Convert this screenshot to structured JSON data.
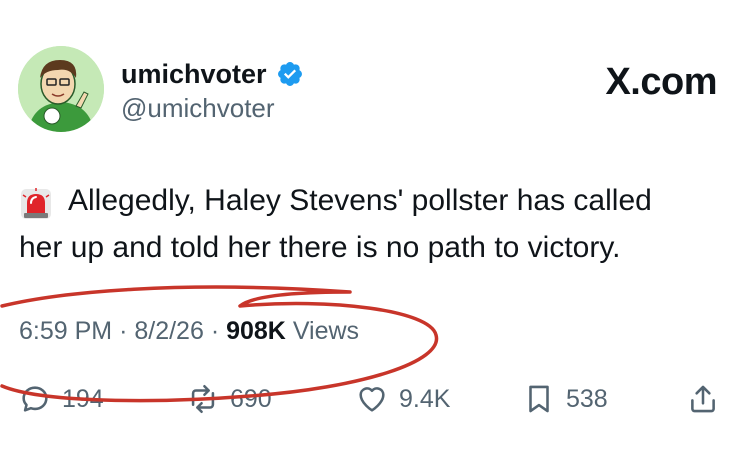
{
  "user": {
    "display_name": "umichvoter",
    "handle": "@umichvoter"
  },
  "brand": "X.com",
  "tweet": {
    "line1": "Allegedly, Haley Stevens' pollster has called",
    "line2": "her up and told her there is no path to victory."
  },
  "meta": {
    "time": "6:59 PM",
    "sep1": "·",
    "date": "8/2/26",
    "sep2": "·",
    "views_count": "908K",
    "views_label": "Views"
  },
  "actions": {
    "replies": "194",
    "reposts": "690",
    "likes": "9.4K",
    "bookmarks": "538"
  },
  "colors": {
    "text": "#0f1419",
    "secondary": "#536471",
    "verified": "#1d9bf0",
    "annotation": "#c8352a"
  }
}
